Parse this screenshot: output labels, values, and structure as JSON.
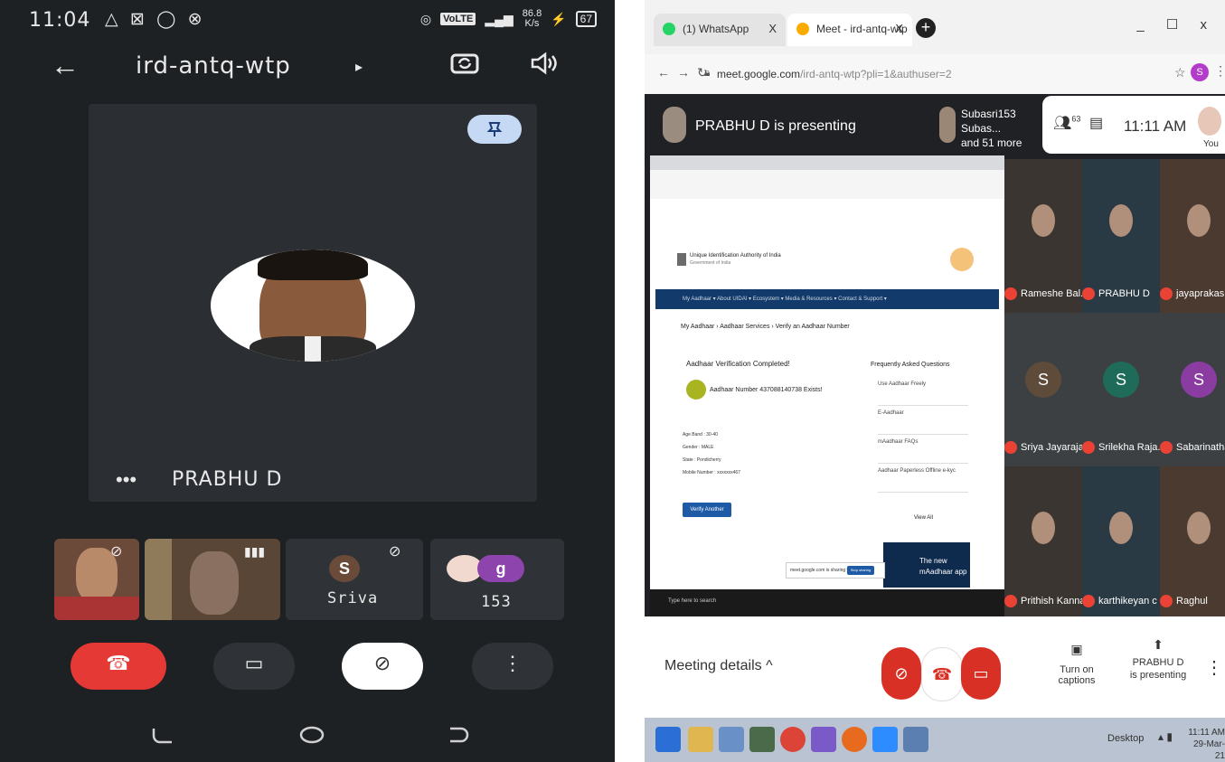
{
  "phone": {
    "status": {
      "time": "11:04",
      "icons": "△ ⊠ ◯ ⊗",
      "volte": "VoLTE",
      "speed_top": "86.8",
      "speed_unit": "K/s",
      "battery": "67"
    },
    "header": {
      "back": "←",
      "title": "ird-antq-wtp",
      "caret": "▸",
      "camera_flip": "⟳",
      "speaker": "◁)"
    },
    "pin_icon": "⚲",
    "main_tile": {
      "name": "PRABHU D",
      "dots": "•••"
    },
    "strip": [
      {
        "label": ""
      },
      {
        "label": ""
      },
      {
        "avatar": "S",
        "label": "Sriva"
      },
      {
        "avatar": "g",
        "label": "153"
      }
    ],
    "controls": {
      "end": "☎",
      "camera": "▭",
      "mic": "⊘",
      "more": "⋮"
    },
    "nav": {
      "back": "◯",
      "home": "◯",
      "recent": "◯"
    }
  },
  "desktop": {
    "tabs": [
      {
        "title": "(1) WhatsApp",
        "close": "X"
      },
      {
        "title": "Meet - ird-antq-wtp",
        "close": "X"
      }
    ],
    "new_tab": "+",
    "window_controls": "_ ☐ x",
    "url_host": "meet.google.com",
    "url_path": "/ird-antq-wtp?pli=1&authuser=2",
    "profile": "S",
    "presenting": "PRABHU D is presenting",
    "others_line1": "Subasri153 Subas...",
    "others_line2": "and 51 more",
    "participant_count": "63",
    "clock": "11:11 AM",
    "you": "You",
    "grid": [
      {
        "name": "Rameshe Bal...",
        "type": "video"
      },
      {
        "name": "PRABHU D",
        "type": "video"
      },
      {
        "name": "jayaprakash ...",
        "type": "video"
      },
      {
        "name": "Sriya Jayarajan",
        "type": "letter",
        "letter": "S",
        "color": "#5f4b39"
      },
      {
        "name": "Srilekha Raja...",
        "type": "letter",
        "letter": "S",
        "color": "#1f6b5a"
      },
      {
        "name": "Sabarinathan...",
        "type": "letter",
        "letter": "S",
        "color": "#8a3ca0"
      },
      {
        "name": "Prithish Kanna",
        "type": "video"
      },
      {
        "name": "karthikeyan c",
        "type": "video"
      },
      {
        "name": "Raghul",
        "type": "video"
      }
    ],
    "bottom": {
      "meeting_details": "Meeting details",
      "caret": "^",
      "captions": "Turn on captions",
      "presenting_line1": "PRABHU D",
      "presenting_line2": "is presenting"
    },
    "shared_page": {
      "org_line1": "Unique Identification Authority of India",
      "org_line2": "Government of India",
      "menu": "My Aadhaar ▾   About UIDAI ▾   Ecosystem ▾   Media & Resources ▾   Contact & Support ▾",
      "breadcrumb": "My Aadhaar  ›  Aadhaar Services  ›  Verify an Aadhaar Number",
      "verify_title": "Aadhaar Verification Completed!",
      "verify_result": "Aadhaar Number 437088140738 Exists!",
      "faq_title": "Frequently Asked Questions",
      "faq": [
        "Use Aadhaar Freely",
        "E-Aadhaar",
        "mAadhaar FAQs",
        "Aadhaar Paperless Offline e-kyc"
      ],
      "view_all": "View All",
      "fields": [
        "Age Band : 30-40",
        "Gender : MALE",
        "State : Pondicherry",
        "Mobile Number : xxxxxxx467"
      ],
      "verify_btn": "Verify Another Aadhaar",
      "banner_line1": "The new",
      "banner_line2": "mAadhaar app",
      "sharing_notice": "meet.google.com is sharing your screen.",
      "stop_sharing": "Stop sharing",
      "hide": "Hide",
      "taskbar_search": "Type here to search"
    },
    "taskbar": {
      "desktop": "Desktop",
      "clock": "11:11 AM",
      "date": "29-Mar-21"
    }
  },
  "colors": {
    "meet_red": "#d93025",
    "meet_dark": "#202124",
    "phone_bg": "#1e2124"
  }
}
